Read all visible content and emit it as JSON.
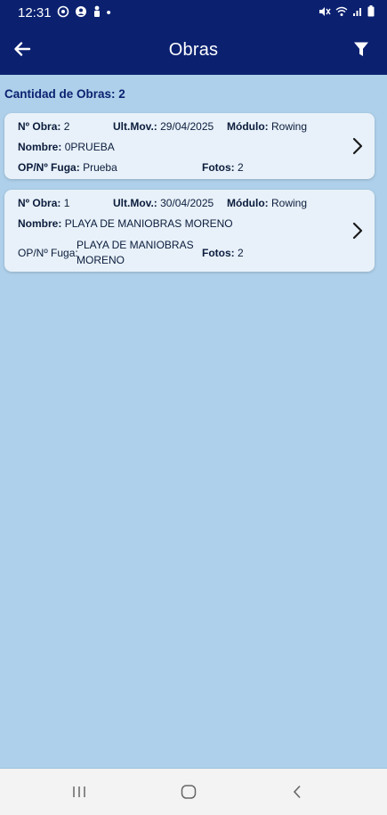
{
  "status_bar": {
    "time": "12:31",
    "dot": "•"
  },
  "app_bar": {
    "title": "Obras"
  },
  "list": {
    "count_label": "Cantidad de Obras: 2",
    "items": [
      {
        "obra_label": "Nº Obra:",
        "obra_value": "2",
        "mov_label": "Ult.Mov.:",
        "mov_value": "29/04/2025",
        "modulo_label": "Módulo:",
        "modulo_value": "Rowing",
        "nombre_label": "Nombre:",
        "nombre_value": "0PRUEBA",
        "op_label": "OP/Nº Fuga:",
        "op_value": "Prueba",
        "fotos_label": "Fotos:",
        "fotos_value": "2"
      },
      {
        "obra_label": "Nº Obra:",
        "obra_value": "1",
        "mov_label": "Ult.Mov.:",
        "mov_value": "30/04/2025",
        "modulo_label": "Módulo:",
        "modulo_value": "Rowing",
        "nombre_label": "Nombre:",
        "nombre_value": "PLAYA DE MANIOBRAS MORENO",
        "op_label": "OP/Nº Fuga:",
        "op_value_line1": "PLAYA DE MANIOBRAS",
        "op_value_line2": "MORENO",
        "fotos_label": "Fotos:",
        "fotos_value": "2"
      }
    ]
  },
  "colors": {
    "primary": "#0b2170",
    "background": "#aed0ea",
    "card": "#e8f1f9"
  },
  "icons": {
    "back": "arrow-left-icon",
    "filter": "funnel-icon",
    "chevron": "chevron-right-icon"
  }
}
